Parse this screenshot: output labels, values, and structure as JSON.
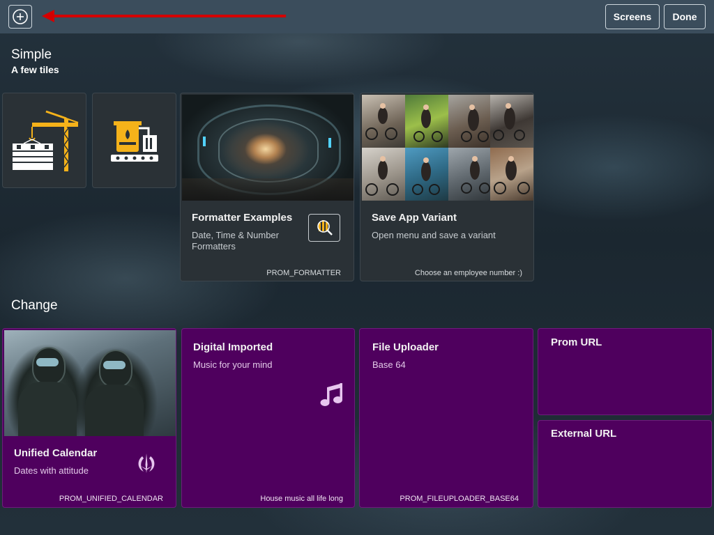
{
  "toolbar": {
    "screens_label": "Screens",
    "done_label": "Done",
    "annotation_color": "#d40000"
  },
  "groups": {
    "simple": {
      "title": "Simple",
      "subtitle": "A few tiles"
    },
    "change": {
      "title": "Change"
    }
  },
  "tiles": {
    "crane": {
      "icon": "crane-icon"
    },
    "factory": {
      "icon": "factory-icon"
    },
    "formatter": {
      "title": "Formatter Examples",
      "subtitle": "Date, Time & Number Formatters",
      "footer": "PROM_FORMATTER",
      "icon": "chart-search-icon"
    },
    "save_variant": {
      "title": "Save App Variant",
      "subtitle": "Open menu and save a variant",
      "footer": "Choose an employee number :)"
    },
    "calendar": {
      "title": "Unified Calendar",
      "subtitle": "Dates with attitude",
      "footer": "PROM_UNIFIED_CALENDAR",
      "icon": "jedi-emblem-icon"
    },
    "digital": {
      "title": "Digital Imported",
      "subtitle": "Music for your mind",
      "footer": "House music all life long",
      "icon": "music-note-icon"
    },
    "uploader": {
      "title": "File Uploader",
      "subtitle": "Base 64",
      "footer": "PROM_FILEUPLOADER_BASE64"
    },
    "prom_url": {
      "title": "Prom URL"
    },
    "external_url": {
      "title": "External URL"
    }
  },
  "colors": {
    "purple_tile": "#4f005e",
    "dark_tile": "#2a3136",
    "icon_yellow": "#f5b21a"
  }
}
